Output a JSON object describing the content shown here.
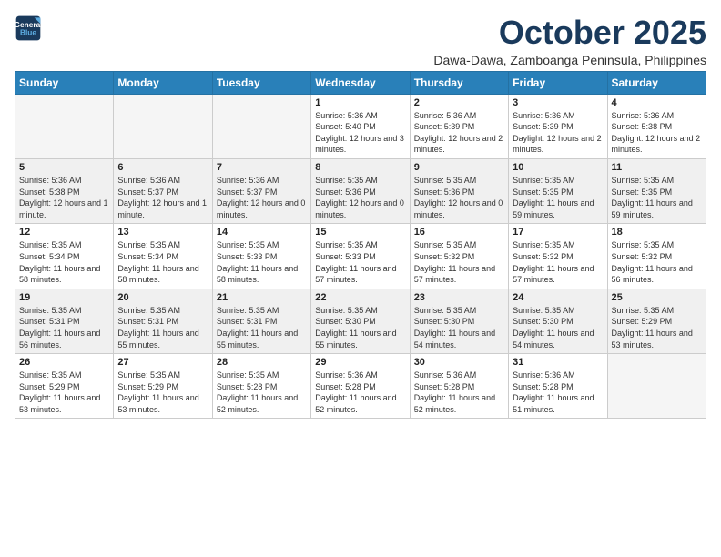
{
  "header": {
    "logo_line1": "General",
    "logo_line2": "Blue",
    "month": "October 2025",
    "location": "Dawa-Dawa, Zamboanga Peninsula, Philippines"
  },
  "weekdays": [
    "Sunday",
    "Monday",
    "Tuesday",
    "Wednesday",
    "Thursday",
    "Friday",
    "Saturday"
  ],
  "weeks": [
    [
      {
        "day": "",
        "info": ""
      },
      {
        "day": "",
        "info": ""
      },
      {
        "day": "",
        "info": ""
      },
      {
        "day": "1",
        "info": "Sunrise: 5:36 AM\nSunset: 5:40 PM\nDaylight: 12 hours and 3 minutes."
      },
      {
        "day": "2",
        "info": "Sunrise: 5:36 AM\nSunset: 5:39 PM\nDaylight: 12 hours and 2 minutes."
      },
      {
        "day": "3",
        "info": "Sunrise: 5:36 AM\nSunset: 5:39 PM\nDaylight: 12 hours and 2 minutes."
      },
      {
        "day": "4",
        "info": "Sunrise: 5:36 AM\nSunset: 5:38 PM\nDaylight: 12 hours and 2 minutes."
      }
    ],
    [
      {
        "day": "5",
        "info": "Sunrise: 5:36 AM\nSunset: 5:38 PM\nDaylight: 12 hours and 1 minute."
      },
      {
        "day": "6",
        "info": "Sunrise: 5:36 AM\nSunset: 5:37 PM\nDaylight: 12 hours and 1 minute."
      },
      {
        "day": "7",
        "info": "Sunrise: 5:36 AM\nSunset: 5:37 PM\nDaylight: 12 hours and 0 minutes."
      },
      {
        "day": "8",
        "info": "Sunrise: 5:35 AM\nSunset: 5:36 PM\nDaylight: 12 hours and 0 minutes."
      },
      {
        "day": "9",
        "info": "Sunrise: 5:35 AM\nSunset: 5:36 PM\nDaylight: 12 hours and 0 minutes."
      },
      {
        "day": "10",
        "info": "Sunrise: 5:35 AM\nSunset: 5:35 PM\nDaylight: 11 hours and 59 minutes."
      },
      {
        "day": "11",
        "info": "Sunrise: 5:35 AM\nSunset: 5:35 PM\nDaylight: 11 hours and 59 minutes."
      }
    ],
    [
      {
        "day": "12",
        "info": "Sunrise: 5:35 AM\nSunset: 5:34 PM\nDaylight: 11 hours and 58 minutes."
      },
      {
        "day": "13",
        "info": "Sunrise: 5:35 AM\nSunset: 5:34 PM\nDaylight: 11 hours and 58 minutes."
      },
      {
        "day": "14",
        "info": "Sunrise: 5:35 AM\nSunset: 5:33 PM\nDaylight: 11 hours and 58 minutes."
      },
      {
        "day": "15",
        "info": "Sunrise: 5:35 AM\nSunset: 5:33 PM\nDaylight: 11 hours and 57 minutes."
      },
      {
        "day": "16",
        "info": "Sunrise: 5:35 AM\nSunset: 5:32 PM\nDaylight: 11 hours and 57 minutes."
      },
      {
        "day": "17",
        "info": "Sunrise: 5:35 AM\nSunset: 5:32 PM\nDaylight: 11 hours and 57 minutes."
      },
      {
        "day": "18",
        "info": "Sunrise: 5:35 AM\nSunset: 5:32 PM\nDaylight: 11 hours and 56 minutes."
      }
    ],
    [
      {
        "day": "19",
        "info": "Sunrise: 5:35 AM\nSunset: 5:31 PM\nDaylight: 11 hours and 56 minutes."
      },
      {
        "day": "20",
        "info": "Sunrise: 5:35 AM\nSunset: 5:31 PM\nDaylight: 11 hours and 55 minutes."
      },
      {
        "day": "21",
        "info": "Sunrise: 5:35 AM\nSunset: 5:31 PM\nDaylight: 11 hours and 55 minutes."
      },
      {
        "day": "22",
        "info": "Sunrise: 5:35 AM\nSunset: 5:30 PM\nDaylight: 11 hours and 55 minutes."
      },
      {
        "day": "23",
        "info": "Sunrise: 5:35 AM\nSunset: 5:30 PM\nDaylight: 11 hours and 54 minutes."
      },
      {
        "day": "24",
        "info": "Sunrise: 5:35 AM\nSunset: 5:30 PM\nDaylight: 11 hours and 54 minutes."
      },
      {
        "day": "25",
        "info": "Sunrise: 5:35 AM\nSunset: 5:29 PM\nDaylight: 11 hours and 53 minutes."
      }
    ],
    [
      {
        "day": "26",
        "info": "Sunrise: 5:35 AM\nSunset: 5:29 PM\nDaylight: 11 hours and 53 minutes."
      },
      {
        "day": "27",
        "info": "Sunrise: 5:35 AM\nSunset: 5:29 PM\nDaylight: 11 hours and 53 minutes."
      },
      {
        "day": "28",
        "info": "Sunrise: 5:35 AM\nSunset: 5:28 PM\nDaylight: 11 hours and 52 minutes."
      },
      {
        "day": "29",
        "info": "Sunrise: 5:36 AM\nSunset: 5:28 PM\nDaylight: 11 hours and 52 minutes."
      },
      {
        "day": "30",
        "info": "Sunrise: 5:36 AM\nSunset: 5:28 PM\nDaylight: 11 hours and 52 minutes."
      },
      {
        "day": "31",
        "info": "Sunrise: 5:36 AM\nSunset: 5:28 PM\nDaylight: 11 hours and 51 minutes."
      },
      {
        "day": "",
        "info": ""
      }
    ]
  ]
}
